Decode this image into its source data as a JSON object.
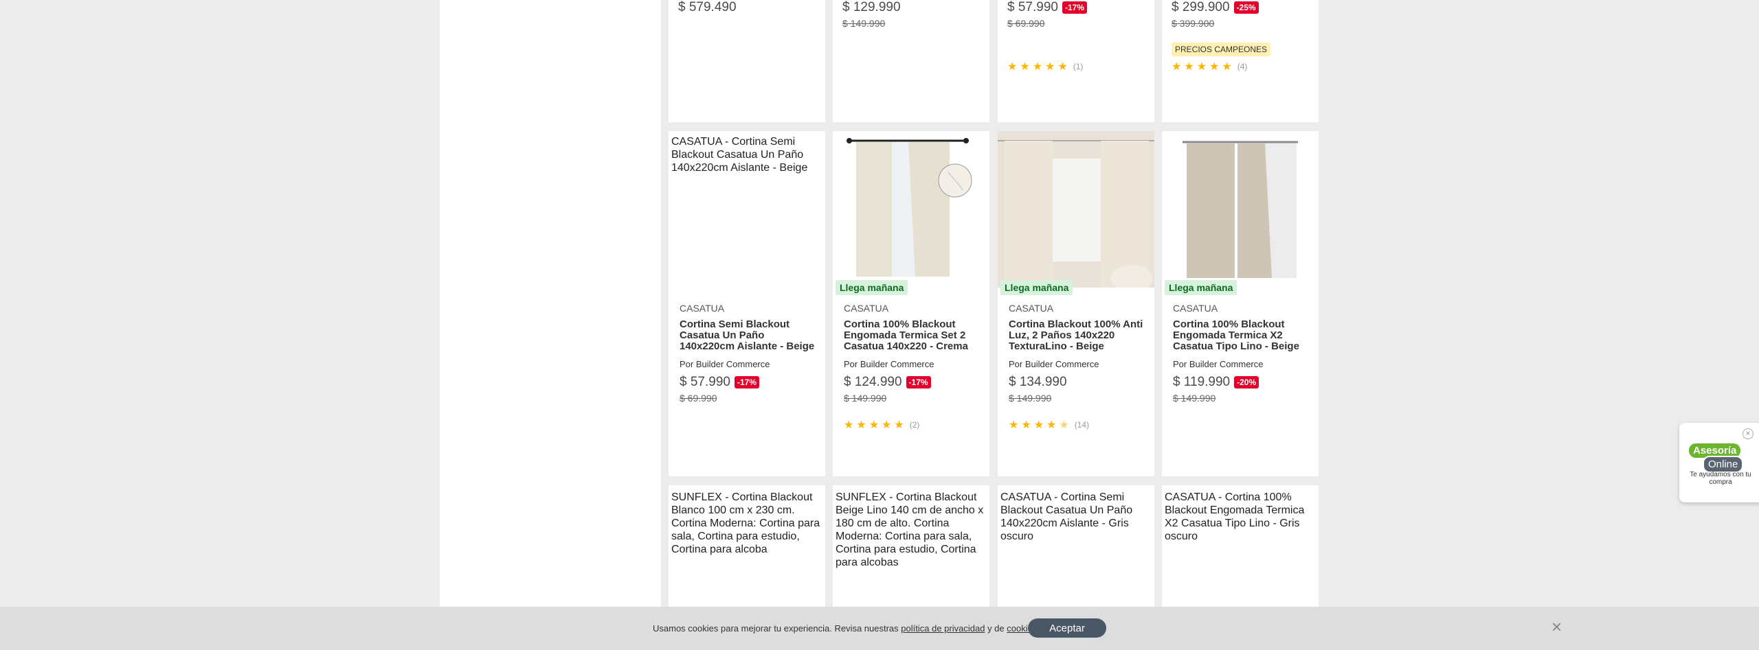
{
  "row1": [
    {
      "price": "$ 579.490"
    },
    {
      "price": "$ 129.990",
      "old": "$ 149.990"
    },
    {
      "price": "$ 57.990",
      "discount": "-17%",
      "old": "$ 69.990",
      "rating_count": "(1)"
    },
    {
      "price": "$ 299.900",
      "discount": "-25%",
      "old": "$ 399.900",
      "badge": "PRECIOS CAMPEONES",
      "rating_count": "(4)"
    }
  ],
  "row2": [
    {
      "image_alt": "CASATUA - Cortina Semi Blackout Casatua Un Paño 140x220cm Aislante - Beige",
      "brand": "CASATUA",
      "name": "Cortina Semi Blackout Casatua Un Paño 140x220cm Aislante - Beige",
      "seller": "Por Builder Commerce",
      "price": "$ 57.990",
      "discount": "-17%",
      "old": "$ 69.990"
    },
    {
      "delivery": "Llega mañana",
      "brand": "CASATUA",
      "name": "Cortina 100% Blackout Engomada Termica Set 2 Casatua 140x220 - Crema",
      "seller": "Por Builder Commerce",
      "price": "$ 124.990",
      "discount": "-17%",
      "old": "$ 149.990",
      "rating": 5,
      "rating_count": "(2)"
    },
    {
      "delivery": "Llega mañana",
      "brand": "CASATUA",
      "name": "Cortina Blackout 100% Anti Luz, 2 Paños 140x220 TexturaLino - Beige",
      "seller": "Por Builder Commerce",
      "price": "$ 134.990",
      "old": "$ 149.990",
      "rating": 4.5,
      "rating_count": "(14)"
    },
    {
      "delivery": "Llega mañana",
      "brand": "CASATUA",
      "name": "Cortina 100% Blackout Engomada Termica X2 Casatua Tipo Lino - Beige",
      "seller": "Por Builder Commerce",
      "price": "$ 119.990",
      "discount": "-20%",
      "old": "$ 149.990"
    }
  ],
  "row3": [
    {
      "title": "SUNFLEX - Cortina Blackout Blanco 100 cm x 230 cm. Cortina Moderna: Cortina para sala, Cortina para estudio, Cortina para alcoba"
    },
    {
      "title": "SUNFLEX - Cortina Blackout Beige Lino 140 cm de ancho x 180 cm de alto. Cortina Moderna: Cortina para sala, Cortina para estudio, Cortina para alcobas"
    },
    {
      "title": "CASATUA - Cortina Semi Blackout Casatua Un Paño 140x220cm Aislante - Gris oscuro"
    },
    {
      "title": "CASATUA - Cortina 100% Blackout Engomada Termica X2 Casatua Tipo Lino - Gris oscuro"
    }
  ],
  "cookie": {
    "text_pre": "Usamos cookies para mejorar tu experiencia. Revisa nuestras",
    "link_privacy": "política de privacidad",
    "text_mid": "y de",
    "link_cookies": "cookies",
    "text_end": ".",
    "accept": "Aceptar",
    "close_icon": "×"
  },
  "asesoria": {
    "line1": "Asesoría",
    "line2": "Online",
    "sub": "Te ayudamos con tu compra",
    "close_icon": "×"
  },
  "icons": {
    "star": "★",
    "star_half": "★"
  },
  "colors": {
    "discount": "#e4002b",
    "delivery_bg": "#d8f1dd",
    "delivery_text": "#0b6b1f",
    "star": "#ffb400"
  }
}
